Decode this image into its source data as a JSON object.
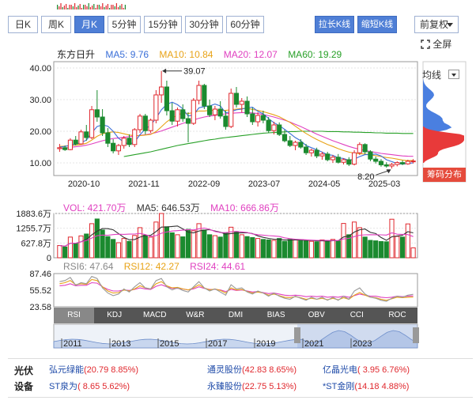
{
  "period_tabs": [
    "日K",
    "周K",
    "月K",
    "5分钟",
    "15分钟",
    "30分钟",
    "60分钟"
  ],
  "active_tab": "月K",
  "toolbar": {
    "zoom_in": "拉长K线",
    "zoom_out": "缩短K线",
    "adjust": "前复权",
    "fullscreen": "全屏"
  },
  "main_legend": {
    "name": "东方日升",
    "ma5": "MA5: 9.76",
    "ma10": "MA10: 10.84",
    "ma20": "MA20: 12.07",
    "ma60": "MA60: 19.29"
  },
  "colors": {
    "up": "#e0282e",
    "down": "#1b8a2f",
    "ma5": "#3a6fd8",
    "ma10": "#e8a317",
    "ma20": "#e040c0",
    "ma60": "#28a028",
    "accent": "#4f7fd6"
  },
  "price_axis": [
    "40.00",
    "30.00",
    "20.00",
    "10.00"
  ],
  "annotations": {
    "high": "39.07",
    "low": "8.20"
  },
  "date_axis": [
    "2020-10",
    "2021-11",
    "2022-09",
    "2023-07",
    "2024-05",
    "2025-03"
  ],
  "sidebar": {
    "ma_line": "均线",
    "chip": "筹码分布"
  },
  "volume_legend": {
    "vol": "VOL: 421.70万",
    "ma5": "MA5: 646.53万",
    "ma10": "MA10: 666.86万"
  },
  "volume_axis": [
    "1883.6万",
    "1255.7万",
    "627.8万",
    "0"
  ],
  "rsi_legend": {
    "rsi6": "RSI6: 47.64",
    "rsi12": "RSI12: 42.27",
    "rsi24": "RSI24: 44.61"
  },
  "rsi_axis": [
    "87.46",
    "55.52",
    "23.58"
  ],
  "indicator_tabs": [
    "RSI",
    "KDJ",
    "MACD",
    "W&R",
    "DMI",
    "BIAS",
    "OBV",
    "CCI",
    "ROC"
  ],
  "active_indicator": "RSI",
  "timeline_years": [
    "2011",
    "2013",
    "2015",
    "2017",
    "2019",
    "2021",
    "2023"
  ],
  "sector": {
    "title": "光伏设备",
    "stocks": [
      {
        "name": "弘元绿能",
        "value": "(20.79 8.85%)"
      },
      {
        "name": "通灵股份",
        "value": "(42.83 8.65%)"
      },
      {
        "name": "亿晶光电",
        "value": "( 3.95 6.76%)"
      },
      {
        "name": "ST泉为",
        "value": "( 8.65 5.62%)"
      },
      {
        "name": "永臻股份",
        "value": "(22.75 5.13%)"
      },
      {
        "name": "*ST金刚",
        "value": "(14.18 4.88%)"
      }
    ]
  },
  "chart_data": {
    "type": "candlestick",
    "candles": [
      [
        14.5,
        16.0,
        13.5,
        14.8
      ],
      [
        14.8,
        15.5,
        13.8,
        14.2
      ],
      [
        14.2,
        17.8,
        14.0,
        17.2
      ],
      [
        17.2,
        18.5,
        15.5,
        16.0
      ],
      [
        16.0,
        20.5,
        15.8,
        19.8
      ],
      [
        19.8,
        22.0,
        17.0,
        18.0
      ],
      [
        18.0,
        28.0,
        17.5,
        26.8
      ],
      [
        26.8,
        33.0,
        23.0,
        24.5
      ],
      [
        24.5,
        27.0,
        18.5,
        19.5
      ],
      [
        19.5,
        21.0,
        15.0,
        16.2
      ],
      [
        16.2,
        17.5,
        13.0,
        13.8
      ],
      [
        13.8,
        16.0,
        12.5,
        15.5
      ],
      [
        15.5,
        18.5,
        14.5,
        17.8
      ],
      [
        17.8,
        19.0,
        15.0,
        15.8
      ],
      [
        15.8,
        21.0,
        15.0,
        20.5
      ],
      [
        20.5,
        25.5,
        19.5,
        24.8
      ],
      [
        24.8,
        25.5,
        19.0,
        20.2
      ],
      [
        20.2,
        24.0,
        19.5,
        23.5
      ],
      [
        23.5,
        33.0,
        22.5,
        31.5
      ],
      [
        31.5,
        39.07,
        29.0,
        34.0
      ],
      [
        34.0,
        36.0,
        25.0,
        26.5
      ],
      [
        26.5,
        29.0,
        22.0,
        23.2
      ],
      [
        23.2,
        27.5,
        21.5,
        26.8
      ],
      [
        26.8,
        28.5,
        23.0,
        24.0
      ],
      [
        24.0,
        26.0,
        16.5,
        22.5
      ],
      [
        22.5,
        30.5,
        22.0,
        29.8
      ],
      [
        29.8,
        36.0,
        28.5,
        34.5
      ],
      [
        34.5,
        35.0,
        27.0,
        28.0
      ],
      [
        28.0,
        30.0,
        24.5,
        25.2
      ],
      [
        25.2,
        28.0,
        23.5,
        27.0
      ],
      [
        27.0,
        29.5,
        24.0,
        24.8
      ],
      [
        24.8,
        26.5,
        20.5,
        21.5
      ],
      [
        21.5,
        33.5,
        21.0,
        32.0
      ],
      [
        32.0,
        34.0,
        27.5,
        28.5
      ],
      [
        28.5,
        30.5,
        26.0,
        29.5
      ],
      [
        29.5,
        31.0,
        24.5,
        25.5
      ],
      [
        25.5,
        27.5,
        22.0,
        23.0
      ],
      [
        23.0,
        26.0,
        21.5,
        25.0
      ],
      [
        25.0,
        26.5,
        22.5,
        23.5
      ],
      [
        23.5,
        24.5,
        19.5,
        20.2
      ],
      [
        20.2,
        23.0,
        19.0,
        22.0
      ],
      [
        22.0,
        22.8,
        18.5,
        19.0
      ],
      [
        19.0,
        20.5,
        16.5,
        17.0
      ],
      [
        17.0,
        18.5,
        15.0,
        15.5
      ],
      [
        15.5,
        17.0,
        14.0,
        16.5
      ],
      [
        16.5,
        17.5,
        14.5,
        15.0
      ],
      [
        15.0,
        16.0,
        12.5,
        13.2
      ],
      [
        13.2,
        14.5,
        12.0,
        14.0
      ],
      [
        14.0,
        14.8,
        11.5,
        12.2
      ],
      [
        12.2,
        13.5,
        11.0,
        12.8
      ],
      [
        12.8,
        13.5,
        10.5,
        11.0
      ],
      [
        11.0,
        12.5,
        10.0,
        11.8
      ],
      [
        11.8,
        12.8,
        9.8,
        10.2
      ],
      [
        10.2,
        11.5,
        9.5,
        11.0
      ],
      [
        11.0,
        11.8,
        9.0,
        9.6
      ],
      [
        9.6,
        14.0,
        9.2,
        13.2
      ],
      [
        13.2,
        16.5,
        12.5,
        15.8
      ],
      [
        15.8,
        16.2,
        12.8,
        13.5
      ],
      [
        13.5,
        14.0,
        10.5,
        11.2
      ],
      [
        11.2,
        12.0,
        9.8,
        10.5
      ],
      [
        10.5,
        11.2,
        8.8,
        9.4
      ],
      [
        9.4,
        10.2,
        8.5,
        9.0
      ],
      [
        9.0,
        10.0,
        8.2,
        9.5
      ],
      [
        9.5,
        10.5,
        8.9,
        10.1
      ],
      [
        10.1,
        10.8,
        9.3,
        9.7
      ],
      [
        9.7,
        11.0,
        9.4,
        10.5
      ],
      [
        10.5,
        11.2,
        9.8,
        10.6
      ]
    ],
    "price_range": [
      6,
      42
    ],
    "ma5": [
      15.0,
      15.2,
      15.6,
      15.9,
      16.4,
      17.2,
      19.5,
      21.5,
      22.0,
      21.6,
      20.0,
      17.8,
      16.6,
      15.8,
      16.6,
      18.9,
      20.7,
      22.0,
      24.1,
      26.8,
      28.5,
      29.2,
      28.4,
      27.1,
      24.8,
      25.2,
      27.4,
      27.8,
      28.0,
      28.6,
      28.0,
      25.8,
      26.2,
      26.8,
      27.0,
      27.4,
      27.6,
      26.3,
      25.5,
      24.0,
      22.7,
      21.8,
      20.6,
      19.3,
      18.0,
      17.0,
      15.5,
      14.8,
      14.2,
      13.4,
      12.6,
      12.4,
      11.6,
      11.4,
      10.8,
      11.2,
      12.0,
      12.6,
      12.6,
      12.8,
      12.2,
      11.0,
      10.4,
      9.8,
      9.6,
      9.8,
      10.0
    ],
    "ma10": [
      15.2,
      15.3,
      15.4,
      15.6,
      15.8,
      16.2,
      17.2,
      18.4,
      19.2,
      19.6,
      19.8,
      19.6,
      19.2,
      18.8,
      18.6,
      18.6,
      18.8,
      19.0,
      19.9,
      21.4,
      23.0,
      24.2,
      25.1,
      25.8,
      25.6,
      25.9,
      26.4,
      26.4,
      26.6,
      26.6,
      26.6,
      26.6,
      26.8,
      27.0,
      27.2,
      27.2,
      26.9,
      26.6,
      26.2,
      25.7,
      25.2,
      24.6,
      23.7,
      22.8,
      21.6,
      20.4,
      19.3,
      18.3,
      17.4,
      16.6,
      15.8,
      15.2,
      14.5,
      13.9,
      13.4,
      13.1,
      12.9,
      12.8,
      12.5,
      12.3,
      12.0,
      11.7,
      11.5,
      11.2,
      10.9,
      10.7,
      10.8
    ],
    "ma20": [
      14.5,
      14.7,
      14.9,
      15.1,
      15.3,
      15.6,
      16.0,
      16.5,
      17.0,
      17.4,
      17.7,
      17.9,
      18.1,
      18.3,
      18.5,
      18.7,
      18.9,
      19.2,
      19.6,
      20.1,
      20.7,
      21.3,
      21.9,
      22.5,
      23.0,
      23.6,
      24.1,
      24.5,
      24.8,
      25.0,
      25.3,
      25.5,
      25.7,
      25.8,
      25.9,
      25.9,
      25.8,
      25.6,
      25.3,
      24.9,
      24.5,
      24.0,
      23.5,
      22.9,
      22.2,
      21.5,
      20.7,
      19.9,
      19.1,
      18.4,
      17.7,
      17.0,
      16.4,
      15.8,
      15.2,
      14.7,
      14.3,
      13.9,
      13.6,
      13.3,
      13.0,
      12.8,
      12.6,
      12.4,
      12.2,
      12.1,
      12.07
    ],
    "ma60": [
      null,
      null,
      null,
      null,
      null,
      null,
      null,
      null,
      null,
      null,
      null,
      null,
      12.0,
      12.3,
      12.6,
      12.9,
      13.2,
      13.5,
      13.9,
      14.3,
      14.7,
      15.1,
      15.5,
      15.8,
      16.1,
      16.4,
      16.7,
      17.0,
      17.3,
      17.5,
      17.8,
      18.0,
      18.2,
      18.4,
      18.6,
      18.8,
      19.0,
      19.2,
      19.4,
      19.5,
      19.6,
      19.7,
      19.8,
      19.9,
      19.9,
      20.0,
      20.0,
      20.0,
      20.0,
      20.0,
      19.9,
      19.9,
      19.9,
      19.8,
      19.8,
      19.7,
      19.7,
      19.6,
      19.6,
      19.5,
      19.5,
      19.4,
      19.4,
      19.4,
      19.3,
      19.3,
      19.29
    ],
    "volumes": [
      520,
      460,
      880,
      610,
      930,
      1010,
      1450,
      1650,
      1180,
      900,
      780,
      640,
      820,
      700,
      950,
      1280,
      960,
      880,
      1520,
      1883.6,
      1320,
      1060,
      980,
      890,
      1210,
      1150,
      1450,
      1180,
      980,
      940,
      880,
      1050,
      1300,
      1100,
      980,
      900,
      860,
      820,
      780,
      760,
      740,
      820,
      700,
      780,
      760,
      740,
      720,
      700,
      680,
      760,
      700,
      780,
      720,
      1460,
      980,
      1520,
      1280,
      880,
      740,
      720,
      690,
      680,
      1640,
      910,
      880,
      1440,
      421.7
    ],
    "vol_range": [
      0,
      1883.6
    ],
    "rsi6": [
      72,
      74,
      80,
      65,
      70,
      68,
      82,
      78,
      60,
      50,
      45,
      48,
      58,
      52,
      62,
      70,
      60,
      58,
      74,
      78,
      62,
      56,
      60,
      55,
      52,
      62,
      72,
      60,
      54,
      58,
      52,
      46,
      66,
      58,
      60,
      52,
      48,
      54,
      50,
      44,
      50,
      44,
      40,
      38,
      44,
      40,
      36,
      42,
      38,
      42,
      36,
      42,
      36,
      44,
      38,
      54,
      60,
      48,
      42,
      40,
      36,
      34,
      40,
      44,
      42,
      46,
      47.64
    ],
    "rsi12": [
      68,
      70,
      74,
      66,
      68,
      67,
      76,
      74,
      62,
      54,
      50,
      51,
      56,
      54,
      58,
      64,
      60,
      58,
      68,
      72,
      64,
      60,
      61,
      58,
      56,
      60,
      66,
      60,
      56,
      58,
      55,
      50,
      60,
      56,
      57,
      53,
      50,
      52,
      50,
      46,
      48,
      45,
      42,
      41,
      43,
      41,
      38,
      40,
      38,
      40,
      37,
      40,
      37,
      41,
      38,
      46,
      51,
      46,
      42,
      41,
      38,
      36,
      39,
      42,
      41,
      42,
      42.27
    ],
    "rsi24": [
      64,
      65,
      68,
      64,
      65,
      65,
      70,
      69,
      62,
      57,
      54,
      54,
      56,
      55,
      57,
      60,
      58,
      57,
      63,
      66,
      62,
      59,
      59,
      58,
      56,
      58,
      62,
      59,
      57,
      57,
      56,
      53,
      57,
      55,
      56,
      54,
      52,
      53,
      51,
      49,
      50,
      48,
      46,
      45,
      46,
      45,
      43,
      44,
      43,
      44,
      42,
      43,
      42,
      44,
      42,
      45,
      48,
      46,
      44,
      44,
      42,
      41,
      42,
      44,
      43,
      44,
      44.61
    ],
    "rsi_range": [
      23.58,
      87.46
    ]
  }
}
